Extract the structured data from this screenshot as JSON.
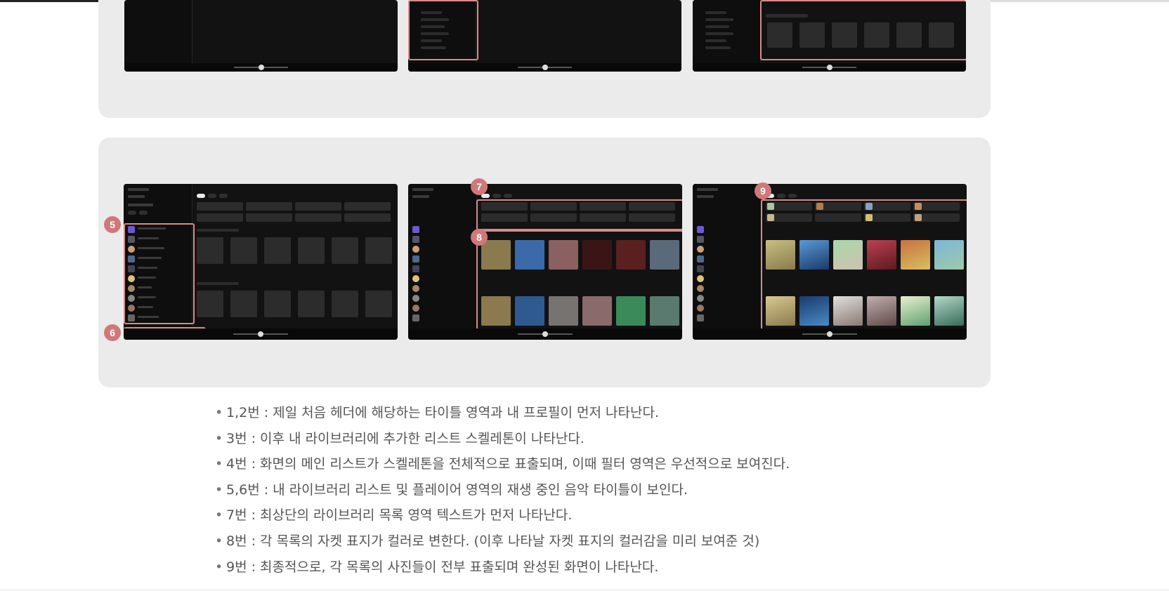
{
  "badges": {
    "b5": "5",
    "b6": "6",
    "b7": "7",
    "b8": "8",
    "b9": "9"
  },
  "notes": [
    "1,2번 : 제일 처음 헤더에 해당하는 타이틀 영역과 내 프로필이 먼저 나타난다.",
    "3번 : 이후 내 라이브러리에 추가한 리스트 스켈레톤이 나타난다.",
    "4번 : 화면의 메인 리스트가 스켈레톤을 전체적으로 표출되며, 이때 필터 영역은 우선적으로 보여진다.",
    "5,6번 : 내 라이브러리 리스트 및 플레이어 영역의 재생 중인 음악 타이틀이 보인다.",
    "7번 : 최상단의 라이브러리 목록 영역 텍스트가 먼저 나타난다.",
    "8번 : 각 목록의 자켓 표지가 컬러로 변한다. (이후 나타날 자켓 표지의 컬러감을 미리 보여준 것)",
    "9번 : 최종적으로, 각 목록의 사진들이 전부 표출되며 완성된 화면이 나타난다."
  ],
  "colors": {
    "panel_bg": "#ebebeb",
    "highlight": "#d98a8a",
    "badge": "#d07878",
    "app_bg": "#121212"
  }
}
